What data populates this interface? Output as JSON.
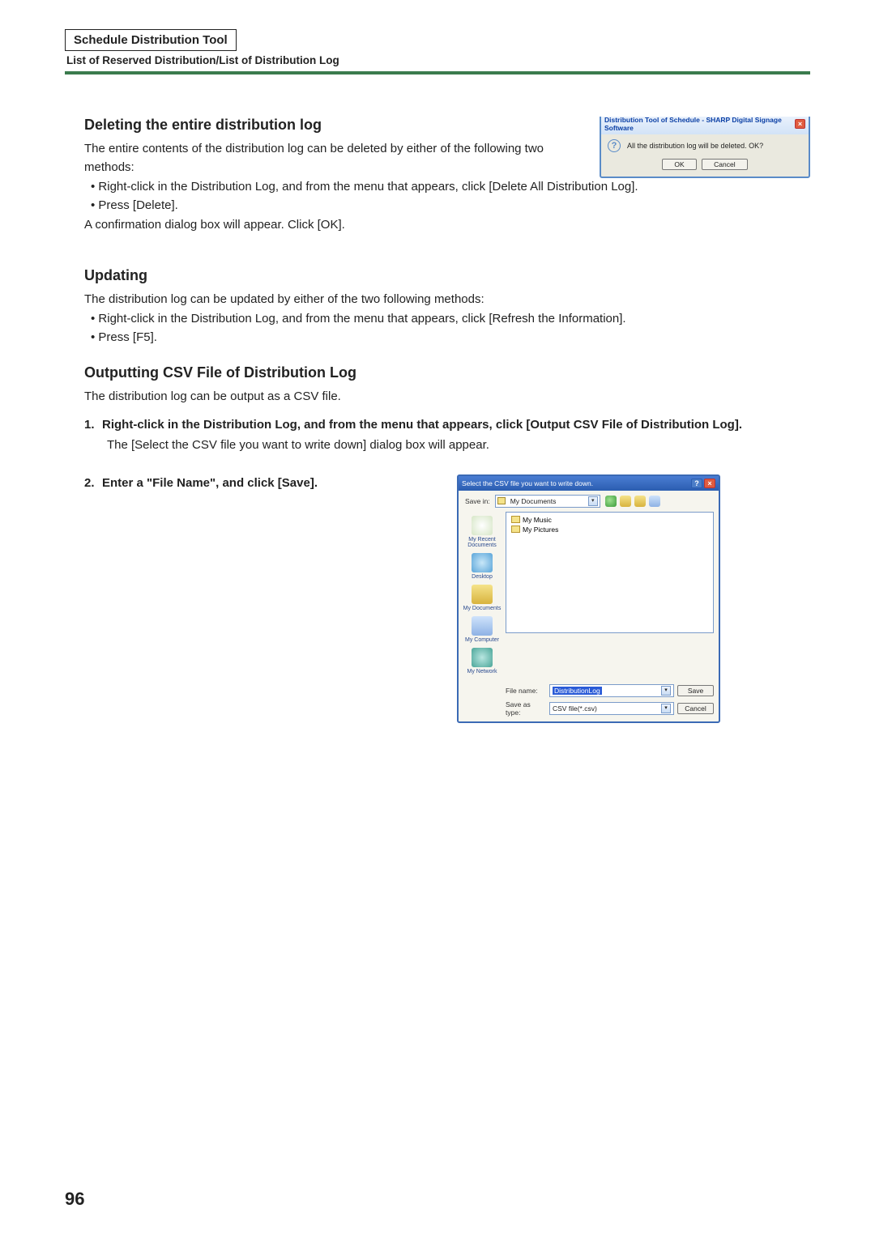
{
  "header": {
    "box_title": "Schedule Distribution Tool",
    "subtitle": "List of Reserved Distribution/List of Distribution Log"
  },
  "section1": {
    "title": "Deleting the entire distribution log",
    "intro": "The entire contents of the distribution log can be deleted by either of the following two methods:",
    "bullets": [
      "Right-click in the Distribution Log, and from the menu that appears, click [Delete All Distribution Log].",
      "Press [Delete]."
    ],
    "after": "A confirmation dialog box will appear. Click [OK]."
  },
  "dialog1": {
    "title": "Distribution Tool of Schedule - SHARP Digital Signage Software",
    "message": "All the distribution log will be deleted. OK?",
    "ok": "OK",
    "cancel": "Cancel"
  },
  "section2": {
    "title": "Updating",
    "intro": "The distribution log can be updated by either of the two following methods:",
    "bullets": [
      "Right-click in the Distribution Log, and from the menu that appears, click [Refresh the Information].",
      "Press [F5]."
    ]
  },
  "section3": {
    "title": "Outputting CSV File of Distribution Log",
    "intro": "The distribution log can be output as a CSV file.",
    "step1_bold": "Right-click in the Distribution Log, and from the menu that appears, click [Output CSV File of Distribution Log].",
    "step1_desc": "The [Select the CSV file you want to write down] dialog box will appear.",
    "step2_bold": "Enter a \"File Name\", and click [Save]."
  },
  "save_dialog": {
    "title": "Select the CSV file you want to write down.",
    "savein_label": "Save in:",
    "savein_value": "My Documents",
    "list_items": [
      "My Music",
      "My Pictures"
    ],
    "sidebar": [
      "My Recent Documents",
      "Desktop",
      "My Documents",
      "My Computer",
      "My Network"
    ],
    "filename_label": "File name:",
    "filename_value": "DistributionLog",
    "type_label": "Save as type:",
    "type_value": "CSV file(*.csv)",
    "save": "Save",
    "cancel": "Cancel"
  },
  "page_number": "96"
}
